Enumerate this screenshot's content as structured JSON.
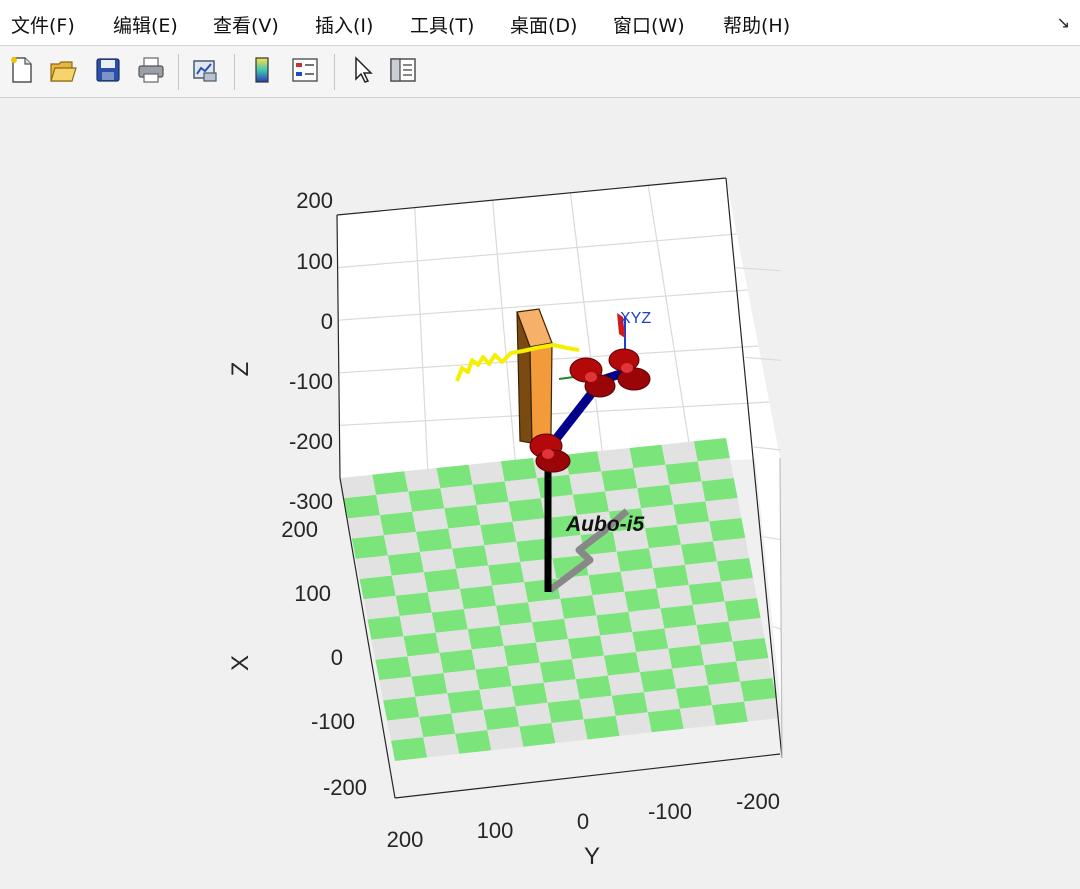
{
  "menu": {
    "items": [
      "文件(F)",
      "编辑(E)",
      "查看(V)",
      "插入(I)",
      "工具(T)",
      "桌面(D)",
      "窗口(W)",
      "帮助(H)"
    ],
    "dock_icon": "dock-arrow-icon"
  },
  "toolbar": {
    "buttons": [
      "new-figure-icon",
      "open-file-icon",
      "save-icon",
      "print-icon",
      "link-plot-icon",
      "colorbar-icon",
      "legend-icon",
      "edit-pointer-icon",
      "property-inspector-icon"
    ]
  },
  "plot": {
    "z_label": "Z",
    "x_label": "X",
    "y_label": "Y",
    "z_ticks": [
      "200",
      "100",
      "0",
      "-100",
      "-200",
      "-300"
    ],
    "x_ticks": [
      "200",
      "100",
      "0",
      "-100",
      "-200"
    ],
    "y_ticks": [
      "200",
      "100",
      "0",
      "-100",
      "-200"
    ],
    "robot_name": "Aubo-i5",
    "end_effector_frame": "XYZ",
    "colors": {
      "floor_green": "#7be57b",
      "floor_grey": "#e2e2e2",
      "trajectory": "#f5f000",
      "joints": "#b3090b",
      "links": "#00008b",
      "box": "#f39b3a",
      "base": "#000000",
      "shadow": "#888888"
    }
  }
}
